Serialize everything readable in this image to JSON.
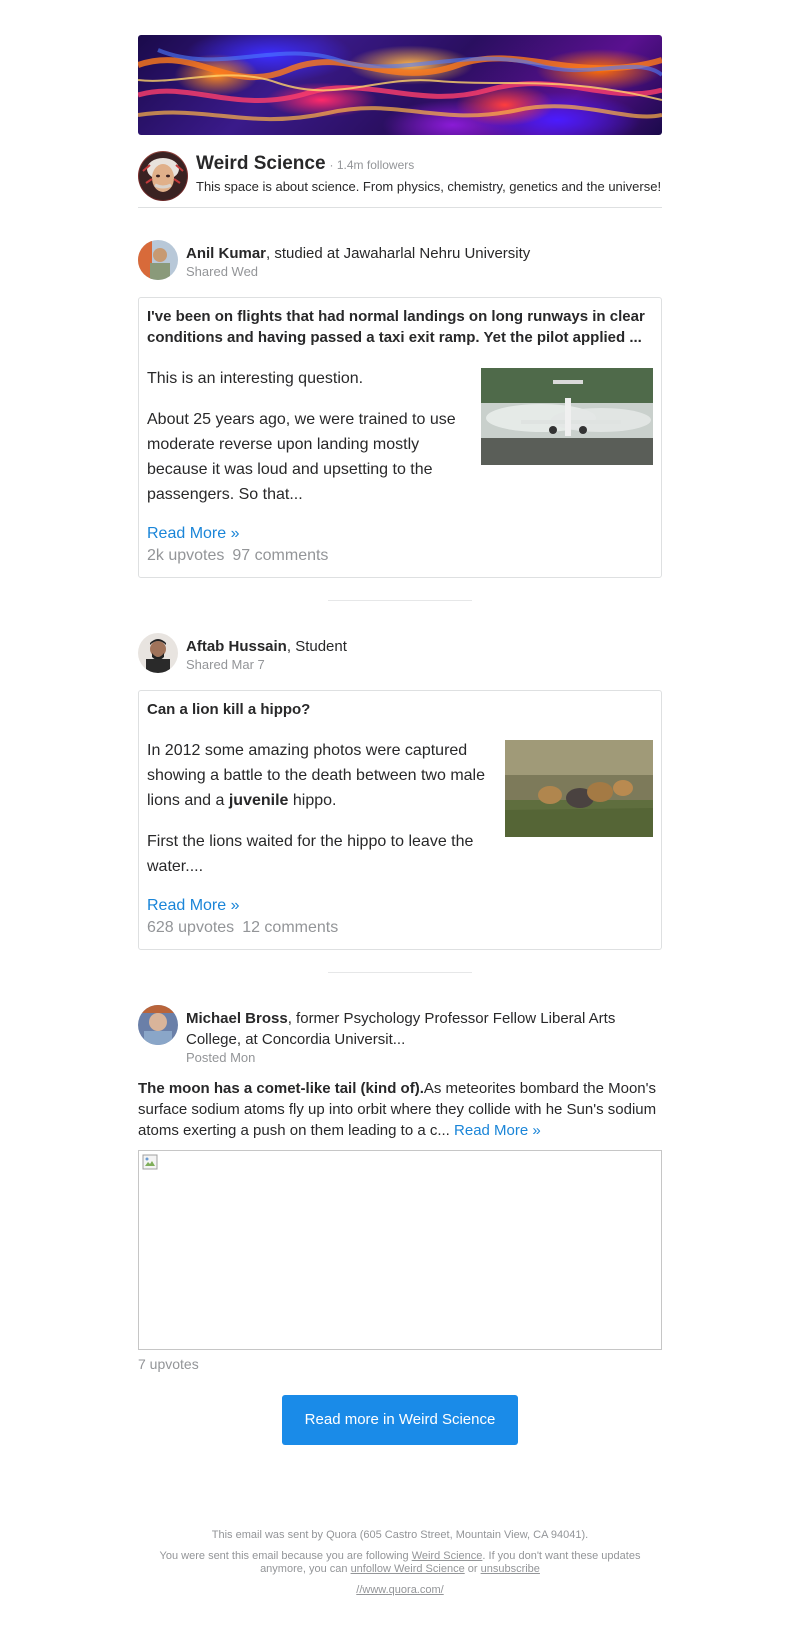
{
  "space": {
    "name": "Weird Science",
    "followers": "· 1.4m followers",
    "description": "This space is about science. From physics, chemistry, genetics and the universe!"
  },
  "posts": [
    {
      "author": "Anil Kumar",
      "credential": ", studied at Jawaharlal Nehru University",
      "shared": "Shared Wed",
      "question": "I've been on flights that had normal landings on long runways in clear conditions and having passed a taxi exit ramp. Yet the pilot applied ...",
      "para1": "This is an interesting question.",
      "para2": "About 25 years ago, we were trained to use moderate reverse upon landing mostly because it was loud and upsetting to the passengers. So that...",
      "read_more": "Read More »",
      "upvotes": "2k upvotes",
      "comments": "97 comments"
    },
    {
      "author": "Aftab Hussain",
      "credential": ", Student",
      "shared": "Shared Mar 7",
      "question": "Can a lion kill a hippo?",
      "para1_a": "In 2012 some amazing photos were captured showing a battle to the death between two male lions and a ",
      "para1_bold": "juvenile",
      "para1_b": " hippo.",
      "para2": "First the lions waited for the hippo to leave the water....",
      "read_more": "Read More »",
      "upvotes": "628 upvotes",
      "comments": "12 comments"
    },
    {
      "author": "Michael Bross",
      "credential": ", former Psychology Professor Fellow Liberal Arts College, at Concordia Universit...",
      "shared": "Posted Mon",
      "title": "The moon has a comet-like tail (kind of).",
      "body": "As meteorites bombard the Moon's surface sodium atoms fly up into orbit where they collide with he Sun's sodium atoms exerting a push on them leading to a c... ",
      "read_more": "Read More »",
      "upvotes": "7 upvotes"
    }
  ],
  "cta": {
    "label": "Read more in Weird Science"
  },
  "footer": {
    "line1": "This email was sent by Quora (605 Castro Street, Mountain View, CA 94041).",
    "line2_a": "You were sent this email because you are following ",
    "line2_link": "Weird Science",
    "line2_b": ". If you don't want these updates anymore, you can ",
    "unfollow": "unfollow Weird Science",
    "or": " or ",
    "unsubscribe": "unsubscribe",
    "url": "//www.quora.com/"
  },
  "colors": {
    "link": "#1a85d8",
    "cta_bg": "#1a8be8",
    "muted": "#939598"
  }
}
